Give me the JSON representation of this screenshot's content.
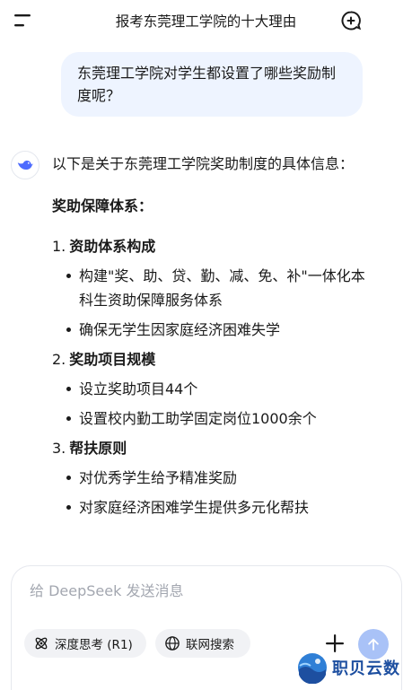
{
  "header": {
    "title": "报考东莞理工学院的十大理由"
  },
  "user_message": "东莞理工学院对学生都设置了哪些奖励制度呢？",
  "answer": {
    "intro": "以下是关于东莞理工学院奖助制度的具体信息：",
    "section_heading": "奖助保障体系：",
    "sections": [
      {
        "number": "1.",
        "title": "资助体系构成",
        "bullets": [
          "构建\"奖、助、贷、勤、减、免、补\"一体化本科生资助保障服务体系",
          "确保无学生因家庭经济困难失学"
        ]
      },
      {
        "number": "2.",
        "title": "奖助项目规模",
        "bullets": [
          "设立奖助项目44个",
          "设置校内勤工助学固定岗位1000余个"
        ]
      },
      {
        "number": "3.",
        "title": "帮扶原则",
        "bullets": [
          "对优秀学生给予精准奖励",
          "对家庭经济困难学生提供多元化帮扶"
        ]
      }
    ]
  },
  "composer": {
    "placeholder": "给 DeepSeek 发送消息",
    "deepthink_label": "深度思考 (R1)",
    "search_label": "联网搜索"
  },
  "watermark": {
    "text": "职贝云数"
  },
  "colors": {
    "accent": "#4d6bfe",
    "user_bubble": "#eef4ff",
    "send_button": "#a9c2f7",
    "chip_bg": "#f1f2f5",
    "watermark": "#1d4fa0"
  },
  "icons": {
    "menu": "menu-icon",
    "new_chat": "new-chat-icon",
    "avatar": "whale-logo-icon",
    "deepthink": "atom-icon",
    "search": "globe-icon",
    "plus": "plus-icon",
    "send": "arrow-up-icon"
  }
}
